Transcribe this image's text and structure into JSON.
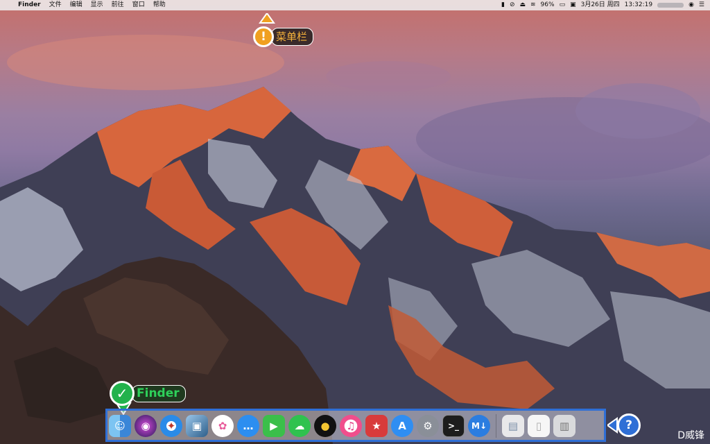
{
  "menubar": {
    "apple_glyph": "",
    "app_name": "Finder",
    "menus": [
      "文件",
      "编辑",
      "显示",
      "前往",
      "窗口",
      "帮助"
    ],
    "battery": "96%",
    "date": "3月26日 周四",
    "time": "13:32:19"
  },
  "callouts": {
    "menubar_label": "菜单栏",
    "menubar_badge": "!",
    "finder_label": "Finder",
    "finder_badge": "✓",
    "dock_badge": "?"
  },
  "dock": {
    "apps": [
      {
        "name": "Finder",
        "glyph": "☺"
      },
      {
        "name": "Siri",
        "glyph": "◉"
      },
      {
        "name": "Safari",
        "glyph": "✦"
      },
      {
        "name": "Preview",
        "glyph": "▣"
      },
      {
        "name": "Photos",
        "glyph": "✿"
      },
      {
        "name": "Messages",
        "glyph": "…"
      },
      {
        "name": "FaceTime",
        "glyph": "▶"
      },
      {
        "name": "WeChat",
        "glyph": "☁"
      },
      {
        "name": "QQ",
        "glyph": "●"
      },
      {
        "name": "iTunes",
        "glyph": "♫"
      },
      {
        "name": "Bookmarks",
        "glyph": "★"
      },
      {
        "name": "App Store",
        "glyph": "A"
      },
      {
        "name": "System Preferences",
        "glyph": "⚙"
      },
      {
        "name": "Terminal",
        "glyph": ">_"
      },
      {
        "name": "Markdown",
        "glyph": "M↓"
      }
    ],
    "stacks": [
      {
        "name": "Downloads folder",
        "glyph": "▤"
      },
      {
        "name": "Document",
        "glyph": "▯"
      },
      {
        "name": "Trash",
        "glyph": "▥"
      }
    ]
  },
  "watermark": "D威锋",
  "colors": {
    "menubar_callout": "#f0a020",
    "finder_callout": "#22b24c",
    "dock_callout": "#2f6fd6"
  }
}
